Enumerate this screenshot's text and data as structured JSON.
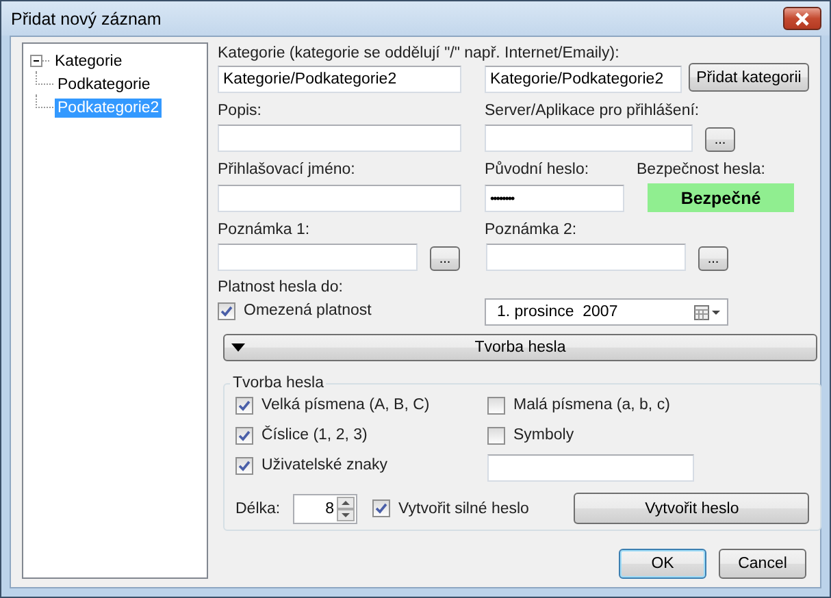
{
  "window": {
    "title": "Přidat nový záznam"
  },
  "tree": {
    "items": [
      {
        "label": "Kategorie",
        "selected": false,
        "expanded": true,
        "children": [
          {
            "label": "Podkategorie",
            "selected": false
          },
          {
            "label": "Podkategorie2",
            "selected": true
          }
        ]
      }
    ]
  },
  "category": {
    "label": "Kategorie (kategorie se oddělují \"/\" např. Internet/Emaily):",
    "value": "Kategorie/Podkategorie2",
    "new_value": "Kategorie/Podkategorie2",
    "add_button": "Přidat kategorii"
  },
  "description": {
    "label": "Popis:"
  },
  "server": {
    "label": "Server/Aplikace pro přihlášení:",
    "browse_button": "..."
  },
  "login": {
    "label": "Přihlašovací jméno:"
  },
  "password": {
    "label": "Původní heslo:",
    "value": "••••••••"
  },
  "strength": {
    "label": "Bezpečnost hesla:",
    "value": "Bezpečné",
    "color": "#90ee90"
  },
  "note1": {
    "label": "Poznámka 1:",
    "browse_button": "..."
  },
  "note2": {
    "label": "Poznámka 2:",
    "browse_button": "..."
  },
  "validity": {
    "label": "Platnost hesla do:",
    "checkbox": "Omezená platnost",
    "checked": true,
    "date": "1. prosince  2007"
  },
  "generator_toggle": {
    "label": "Tvorba hesla",
    "expanded": true
  },
  "generator": {
    "title": "Tvorba hesla",
    "options": [
      {
        "label": "Velká písmena (A, B, C)",
        "checked": true
      },
      {
        "label": "Malá písmena (a, b, c)",
        "checked": false
      },
      {
        "label": "Číslice (1, 2, 3)",
        "checked": true
      },
      {
        "label": "Symboly",
        "checked": false
      },
      {
        "label": "Uživatelské znaky",
        "checked": true
      }
    ],
    "length_label": "Délka:",
    "length": "8",
    "strong": {
      "label": "Vytvořit silné heslo",
      "checked": true
    },
    "create_button": "Vytvořit heslo"
  },
  "buttons": [
    {
      "label": "OK",
      "default": true
    },
    {
      "label": "Cancel",
      "default": false
    }
  ]
}
